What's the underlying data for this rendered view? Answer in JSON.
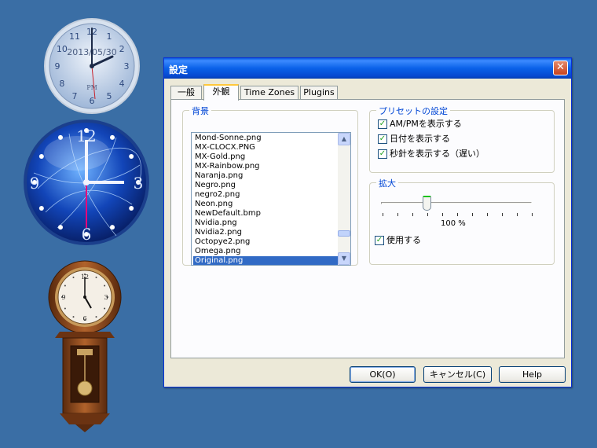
{
  "desktop": {
    "clock1": {
      "date_text": "2013/05/30",
      "ampm_text": "PM",
      "hours": 12
    },
    "clock2": {
      "numerals": [
        "12",
        "3",
        "6",
        "9"
      ]
    },
    "clock3": {
      "numerals": [
        "12",
        "3",
        "6",
        "9"
      ]
    }
  },
  "dialog": {
    "title": "設定",
    "close_glyph": "✕",
    "tabs": [
      {
        "label": "一般",
        "active": false
      },
      {
        "label": "外観",
        "active": true
      },
      {
        "label": "Time Zones",
        "active": false
      },
      {
        "label": "Plugins",
        "active": false
      }
    ],
    "background_group": {
      "label": "背景",
      "items": [
        "Mond-Sonne.png",
        "MX-CLOCX.PNG",
        "MX-Gold.png",
        "MX-Rainbow.png",
        "Naranja.png",
        "Negro.png",
        "negro2.png",
        "Neon.png",
        "NewDefault.bmp",
        "Nvidia.png",
        "Nvidia2.png",
        "Octopye2.png",
        "Omega.png",
        "Original.png"
      ],
      "selected": "Original.png",
      "scroll_up_icon": "▲",
      "scroll_down_icon": "▼"
    },
    "preset_group": {
      "label": "プリセットの設定",
      "options": [
        {
          "label": "AM/PMを表示する",
          "checked": true
        },
        {
          "label": "日付を表示する",
          "checked": true
        },
        {
          "label": "秒針を表示する（遅い）",
          "checked": true
        }
      ]
    },
    "zoom_group": {
      "label": "拡大",
      "value_label": "100 %",
      "slider_fraction": 0.3,
      "use_label": "使用する",
      "use_checked": true
    },
    "buttons": {
      "ok": "OK(O)",
      "cancel": "キャンセル(C)",
      "help": "Help"
    },
    "check_glyph": "✓",
    "colors": {
      "accent": "#0a5ae0",
      "selection": "#316ac5"
    }
  }
}
